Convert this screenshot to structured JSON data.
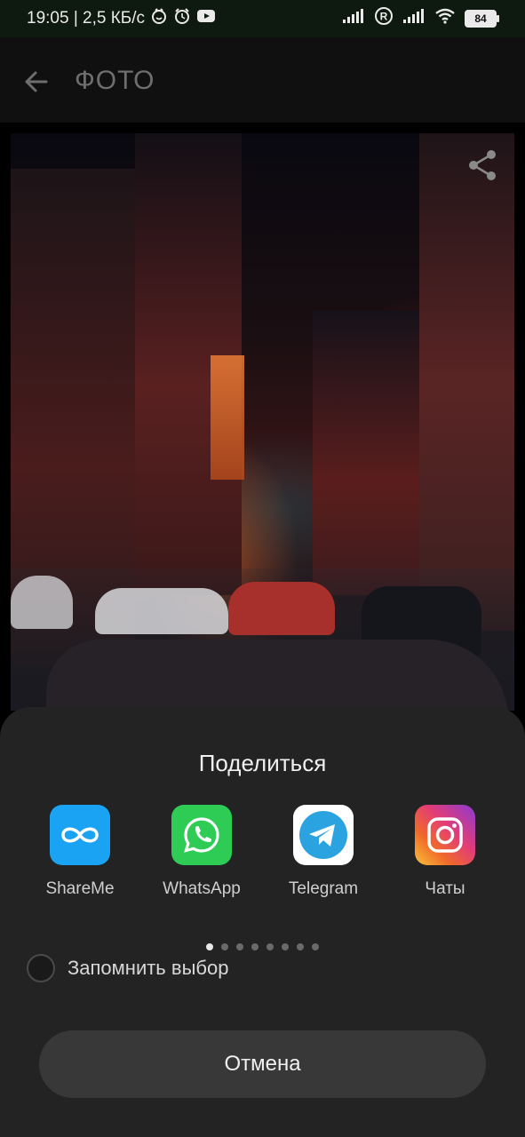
{
  "status_bar": {
    "time_speed": "19:05 | 2,5 КБ/с",
    "battery": "84",
    "roaming": "R"
  },
  "header": {
    "title": "ФОТО"
  },
  "share_sheet": {
    "title": "Поделиться",
    "apps": [
      {
        "label": "ShareMe",
        "icon": "shareme-icon",
        "color": "#1aa3f2"
      },
      {
        "label": "WhatsApp",
        "icon": "whatsapp-icon",
        "color": "#2ecc55"
      },
      {
        "label": "Telegram",
        "icon": "telegram-icon",
        "color": "#2aa3e0"
      },
      {
        "label": "Чаты",
        "icon": "instagram-icon",
        "color": "#e23c78"
      }
    ],
    "page_count": 8,
    "active_page": 1,
    "remember_label": "Запомнить выбор",
    "cancel_label": "Отмена"
  },
  "colors": {
    "sheet_bg": "#232323",
    "appbar_bg": "#101010",
    "statusbar_bg": "#0e1a0f"
  }
}
